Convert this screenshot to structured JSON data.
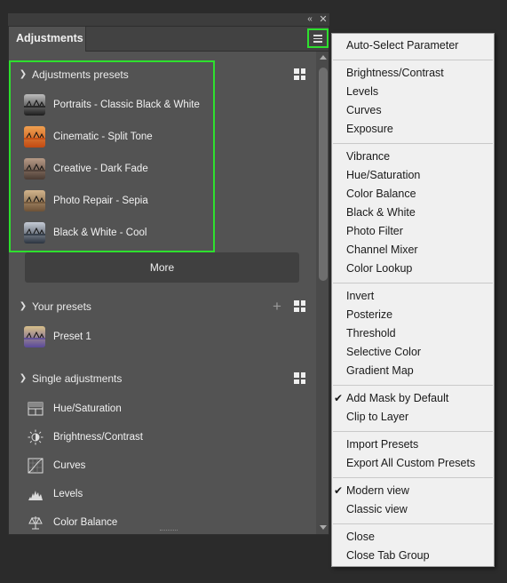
{
  "panel": {
    "tab_label": "Adjustments",
    "sections": {
      "adjustments_presets": {
        "title": "Adjustments presets",
        "items": [
          {
            "label": "Portraits - Classic Black & White",
            "thumb": [
              "#1c1c1c",
              "#bdbdbd"
            ]
          },
          {
            "label": "Cinematic - Split Tone",
            "thumb": [
              "#c24a12",
              "#f0a050"
            ]
          },
          {
            "label": "Creative - Dark Fade",
            "thumb": [
              "#4a3b33",
              "#b79a86"
            ]
          },
          {
            "label": "Photo Repair - Sepia",
            "thumb": [
              "#6d5237",
              "#d2b48c"
            ]
          },
          {
            "label": "Black & White - Cool",
            "thumb": [
              "#2b3440",
              "#c6ccd6"
            ]
          }
        ],
        "more_label": "More"
      },
      "your_presets": {
        "title": "Your presets",
        "items": [
          {
            "label": "Preset 1",
            "thumb": [
              "#5a4a9a",
              "#d8c08a"
            ]
          }
        ]
      },
      "single_adjustments": {
        "title": "Single adjustments",
        "items": [
          {
            "label": "Hue/Saturation",
            "icon": "hue-saturation-icon"
          },
          {
            "label": "Brightness/Contrast",
            "icon": "brightness-contrast-icon"
          },
          {
            "label": "Curves",
            "icon": "curves-icon"
          },
          {
            "label": "Levels",
            "icon": "levels-icon"
          },
          {
            "label": "Color Balance",
            "icon": "color-balance-icon"
          }
        ]
      }
    }
  },
  "menu": {
    "groups": [
      [
        {
          "label": "Auto-Select Parameter"
        }
      ],
      [
        {
          "label": "Brightness/Contrast"
        },
        {
          "label": "Levels"
        },
        {
          "label": "Curves"
        },
        {
          "label": "Exposure"
        }
      ],
      [
        {
          "label": "Vibrance"
        },
        {
          "label": "Hue/Saturation"
        },
        {
          "label": "Color Balance"
        },
        {
          "label": "Black & White"
        },
        {
          "label": "Photo Filter"
        },
        {
          "label": "Channel Mixer"
        },
        {
          "label": "Color Lookup"
        }
      ],
      [
        {
          "label": "Invert"
        },
        {
          "label": "Posterize"
        },
        {
          "label": "Threshold"
        },
        {
          "label": "Selective Color"
        },
        {
          "label": "Gradient Map"
        }
      ],
      [
        {
          "label": "Add Mask by Default",
          "checked": true
        },
        {
          "label": "Clip to Layer"
        }
      ],
      [
        {
          "label": "Import Presets"
        },
        {
          "label": "Export All Custom Presets"
        }
      ],
      [
        {
          "label": "Modern view",
          "checked": true
        },
        {
          "label": "Classic view"
        }
      ],
      [
        {
          "label": "Close"
        },
        {
          "label": "Close Tab Group"
        }
      ]
    ]
  },
  "colors": {
    "highlight": "#2ee02e",
    "panel_bg": "#535353",
    "menu_bg": "#f0f0f0"
  }
}
